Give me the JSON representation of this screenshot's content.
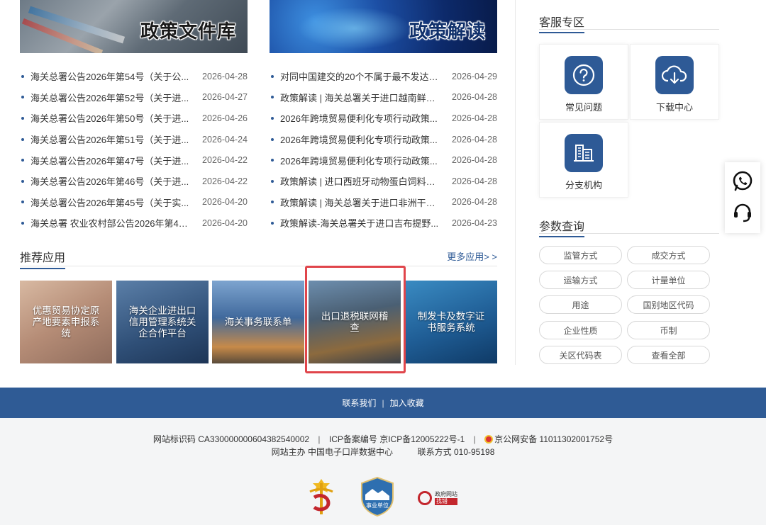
{
  "banners": {
    "left_title": "政策文件库",
    "right_title": "政策解读"
  },
  "news_left": [
    {
      "title": "海关总署公告2026年第54号（关于公...",
      "date": "2026-04-28"
    },
    {
      "title": "海关总署公告2026年第52号（关于进...",
      "date": "2026-04-27"
    },
    {
      "title": "海关总署公告2026年第50号（关于进...",
      "date": "2026-04-26"
    },
    {
      "title": "海关总署公告2026年第51号（关于进...",
      "date": "2026-04-24"
    },
    {
      "title": "海关总署公告2026年第47号（关于进...",
      "date": "2026-04-22"
    },
    {
      "title": "海关总署公告2026年第46号（关于进...",
      "date": "2026-04-22"
    },
    {
      "title": "海关总署公告2026年第45号（关于实...",
      "date": "2026-04-20"
    },
    {
      "title": "海关总署 农业农村部公告2026年第49...",
      "date": "2026-04-20"
    }
  ],
  "news_right": [
    {
      "title": "对同中国建交的20个不属于最不发达国...",
      "date": "2026-04-29"
    },
    {
      "title": "政策解读 | 海关总署关于进口越南鲜食...",
      "date": "2026-04-28"
    },
    {
      "title": "2026年跨境贸易便利化专项行动政策...",
      "date": "2026-04-28"
    },
    {
      "title": "2026年跨境贸易便利化专项行动政策...",
      "date": "2026-04-28"
    },
    {
      "title": "2026年跨境贸易便利化专项行动政策...",
      "date": "2026-04-28"
    },
    {
      "title": "政策解读 | 进口西班牙动物蛋白饲料检...",
      "date": "2026-04-28"
    },
    {
      "title": "政策解读 | 海关总署关于进口非洲干辣...",
      "date": "2026-04-28"
    },
    {
      "title": "政策解读-海关总署关于进口吉布提野...",
      "date": "2026-04-23"
    }
  ],
  "recommend": {
    "title": "推荐应用",
    "more": "更多应用> >",
    "apps": [
      "优惠贸易协定原产地要素申报系统",
      "海关企业进出口信用管理系统关企合作平台",
      "海关事务联系单",
      "出口退税联网稽查",
      "制发卡及数字证书服务系统"
    ]
  },
  "service": {
    "title": "客服专区",
    "items": [
      "常见问题",
      "下载中心",
      "分支机构"
    ]
  },
  "params": {
    "title": "参数查询",
    "items": [
      "监管方式",
      "成交方式",
      "运输方式",
      "计量单位",
      "用途",
      "国别地区代码",
      "企业性质",
      "币制",
      "关区代码表",
      "查看全部"
    ]
  },
  "footer": {
    "contact": "联系我们",
    "favorite": "加入收藏",
    "site_id": "网站标识码 CA330000000604382540002",
    "icp": "ICP备案编号 京ICP备12005222号-1",
    "police": "京公网安备 11011302001752号",
    "host": "网站主办 中国电子口岸数据中心",
    "phone": "联系方式 010-95198",
    "badge_text": "事业单位",
    "gov_top": "政府网站",
    "gov_bottom": "找错"
  },
  "colors": {
    "brand_blue": "#2f5b95",
    "highlight_red": "#e0454b"
  }
}
